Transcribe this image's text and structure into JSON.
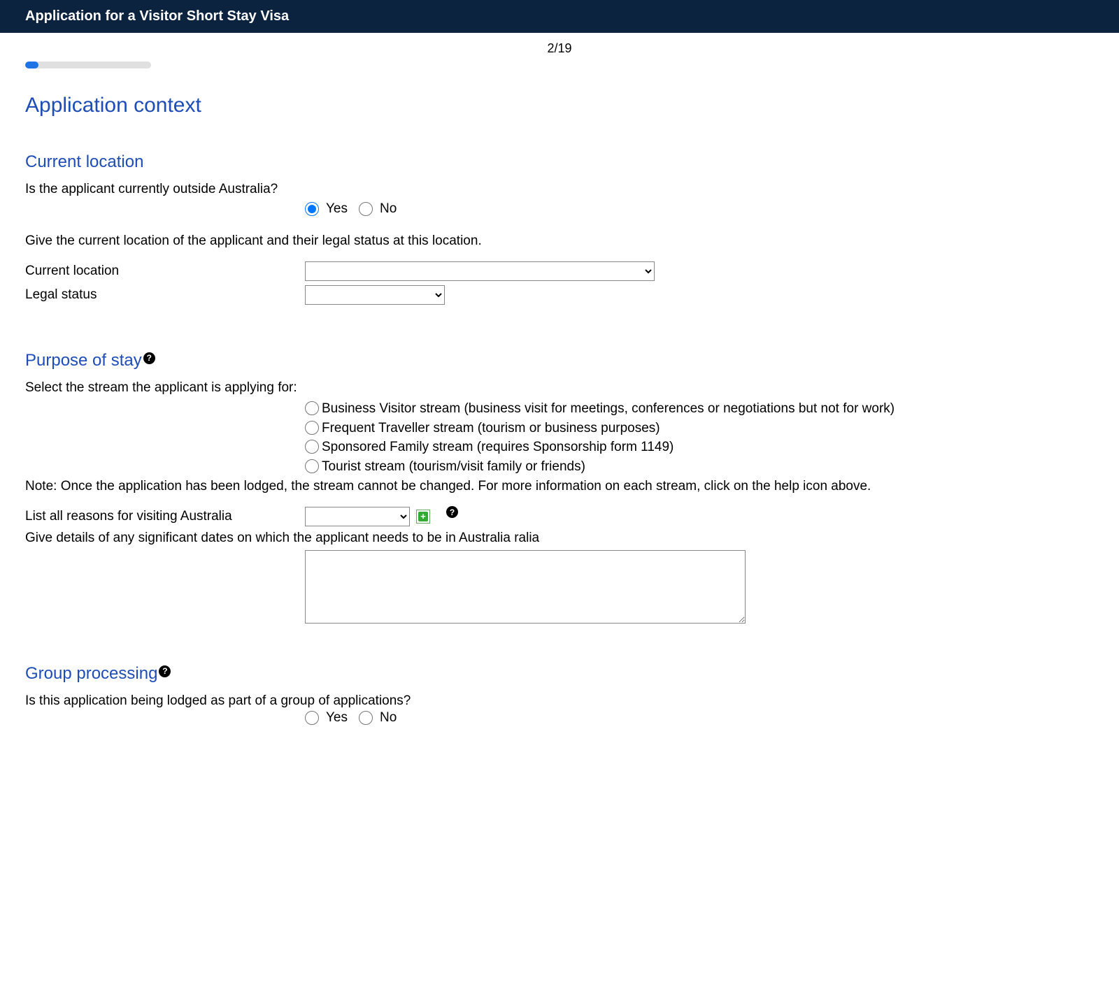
{
  "header": {
    "title": "Application for a Visitor Short Stay Visa"
  },
  "progress": {
    "page_indicator": "2/19"
  },
  "sections": {
    "application_context": {
      "title": "Application context"
    },
    "current_location": {
      "title": "Current location",
      "q_outside": "Is the applicant currently outside Australia?",
      "yes": "Yes",
      "no": "No",
      "instruction": "Give the current location of the applicant and their legal status at this location.",
      "current_location_label": "Current location",
      "legal_status_label": "Legal status"
    },
    "purpose_of_stay": {
      "title": "Purpose of stay",
      "select_stream_label": "Select the stream the applicant is applying for:",
      "streams": [
        "Business Visitor stream (business visit for meetings, conferences or negotiations but not for work)",
        "Frequent Traveller stream (tourism or business purposes)",
        "Sponsored Family stream (requires Sponsorship form 1149)",
        "Tourist stream (tourism/visit family or friends)"
      ],
      "note": "Note: Once the application has been lodged, the stream cannot be changed. For more information on each stream, click on the help icon above.",
      "reasons_label": "List all reasons for visiting Australia",
      "dates_label": "Give details of any significant dates on which the applicant needs to be in Australia ralia"
    },
    "group_processing": {
      "title": "Group processing",
      "question": "Is this application being lodged as part of a group of applications?",
      "yes": "Yes",
      "no": "No"
    }
  }
}
